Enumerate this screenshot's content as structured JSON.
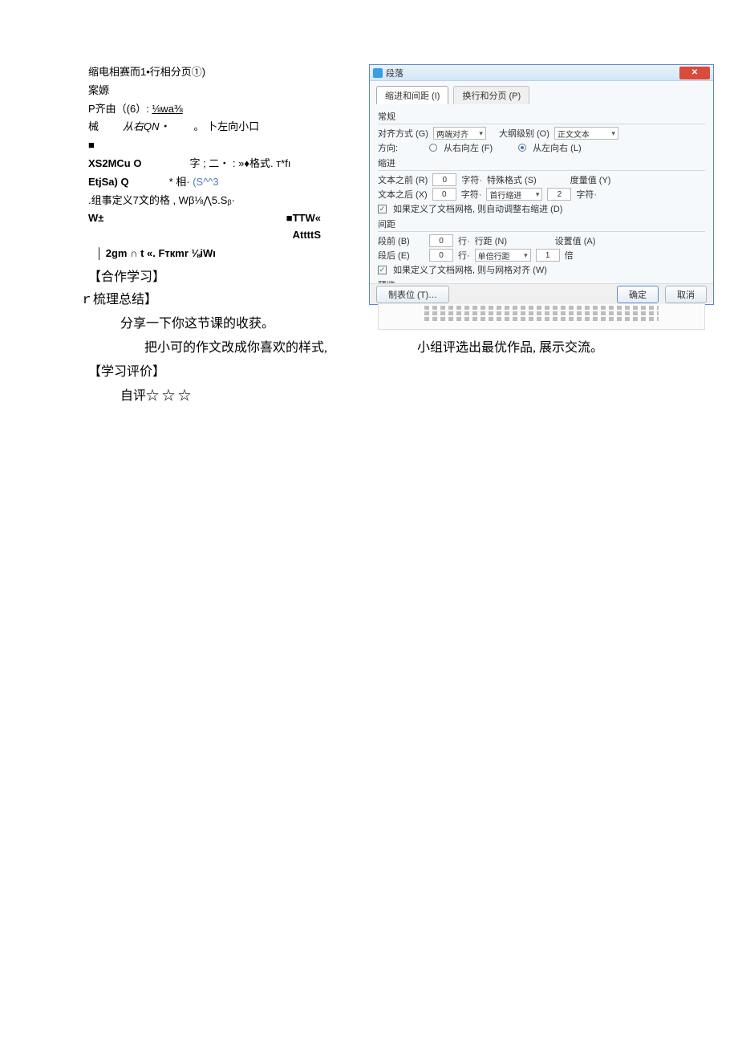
{
  "left_block": {
    "l1": "缩电相赛而1•行相分页①)",
    "l2": "案嫄",
    "l3_a": "P齐由（(6）: ",
    "l3_b": "⅛wa⅜",
    "l4_a": "械",
    "l4_b": "从右QN・",
    "l4_c": " 。 卜左向小口",
    "l5": "■",
    "l6_a": "XS2MCu О",
    "l6_b": "字 ; 二・ : »♦格式. т*fı",
    "l7_a": "EtjSa) Q",
    "l7_b": "* 相· ",
    "l7_c": "(S^^3",
    "l8": ".组事定义7文的格 , Wβ⅛⋀5.Sᵦ·",
    "l9_a": "W±",
    "l9_b": "■TTW«",
    "l9_c": "AttttS",
    "l10": "│ 2gm ∩ t «. Fткmr ⅛iWı"
  },
  "headings": {
    "cooperation": "【合作学习】",
    "summary": "ｒ梳理总结】",
    "evaluation": "【学习评价】"
  },
  "body": {
    "share": "分享一下你这节课的收获。",
    "assign_left": "把小可的作文改成你喜欢的样式,",
    "assign_right": "小组评选出最优作品, 展示交流。",
    "rating": "自评☆  ☆  ☆"
  },
  "dialog": {
    "title": "段落",
    "close_glyph": "✕",
    "tab1": "缩进和间距 (I)",
    "tab2": "换行和分页 (P)",
    "sec_general": "常规",
    "align_label": "对齐方式 (G)",
    "align_value": "两端对齐",
    "outline_label": "大纲级别 (O)",
    "outline_value": "正文文本",
    "direction_label": "方向:",
    "dir_rtl": "从右向左 (F)",
    "dir_ltr": "从左向右 (L)",
    "sec_indent": "缩进",
    "before_text_label": "文本之前 (R)",
    "before_text_val": "0",
    "char_unit": "字符·",
    "special_label": "特殊格式 (S)",
    "metric_label": "度量值 (Y)",
    "after_text_label": "文本之后 (X)",
    "after_text_val": "0",
    "special_value": "首行缩进",
    "metric_value": "2",
    "indent_check": "如果定义了文档网格, 则自动调整右缩进 (D)",
    "sec_spacing": "间距",
    "before_p_label": "段前 (B)",
    "before_p_val": "0",
    "line_unit": "行·",
    "line_spacing_label": "行距 (N)",
    "set_value_label": "设置值 (A)",
    "after_p_label": "段后 (E)",
    "after_p_val": "0",
    "line_spacing_value": "单倍行距",
    "set_value_val": "1",
    "mult_unit": "倍",
    "spacing_check": "如果定义了文档网格, 则与网格对齐 (W)",
    "sec_preview": "预览",
    "btn_tabs": "制表位 (T)…",
    "btn_ok": "确定",
    "btn_cancel": "取消"
  }
}
